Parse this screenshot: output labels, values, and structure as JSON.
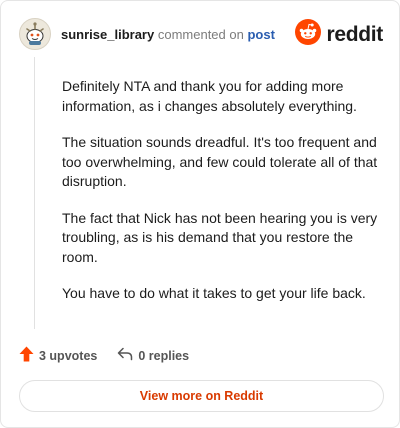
{
  "header": {
    "username": "sunrise_library",
    "action_text": "commented on",
    "post_link": "post",
    "brand_name": "reddit",
    "avatar_icon": "snoo-avatar-icon",
    "brand_icon": "reddit-logo-icon"
  },
  "comment": {
    "paragraphs": [
      "Definitely NTA and thank you for adding more information, as i changes absolutely everything.",
      "The situation sounds dreadful. It's too frequent and too overwhelming, and few could tolerate all of that disruption.",
      "The fact that Nick has not been hearing you is very troubling, as is his demand that you restore the room.",
      "You have to do what it takes to get your life back."
    ]
  },
  "actions": {
    "upvotes_label": "3 upvotes",
    "replies_label": "0 replies",
    "upvote_icon": "upvote-arrow-icon",
    "reply_icon": "reply-icon"
  },
  "footer": {
    "view_button_label": "View more on Reddit"
  },
  "colors": {
    "brand_orange": "#ff4500",
    "link_blue": "#2a5db0",
    "button_text": "#d93a00"
  }
}
